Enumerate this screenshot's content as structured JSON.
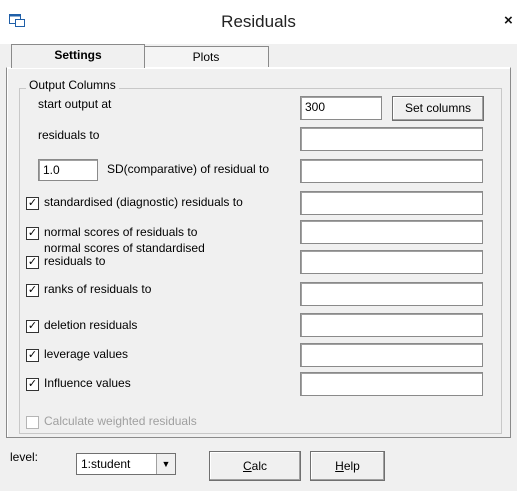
{
  "window": {
    "title": "Residuals",
    "close_symbol": "×"
  },
  "tabs": [
    {
      "label": "Settings",
      "active": true
    },
    {
      "label": "Plots",
      "active": false
    }
  ],
  "output_group": {
    "legend": "Output Columns",
    "start_output_label": "start output at",
    "start_output_value": "300",
    "set_columns_label": "Set columns",
    "residuals_label": "residuals to",
    "residuals_value": "",
    "sd_value": "1.0",
    "sd_label": "SD(comparative) of residual to",
    "sd_output_value": "",
    "options": [
      {
        "label": "standardised (diagnostic) residuals to",
        "checked": true,
        "value": ""
      },
      {
        "label": "normal scores of residuals to",
        "checked": true,
        "value": ""
      },
      {
        "label": "normal scores of standardised residuals to",
        "checked": true,
        "value": ""
      },
      {
        "label": "ranks of residuals to",
        "checked": true,
        "value": ""
      },
      {
        "label": "deletion residuals",
        "checked": true,
        "value": ""
      },
      {
        "label": "leverage values",
        "checked": true,
        "value": ""
      },
      {
        "label": "Influence values",
        "checked": true,
        "value": ""
      }
    ],
    "weighted": {
      "label": "Calculate weighted residuals",
      "checked": false,
      "enabled": false
    }
  },
  "footer": {
    "level_label": "level:",
    "level_value": "1:student",
    "calc_label": "Calc",
    "help_label": "Help"
  },
  "check_symbol": "✓"
}
